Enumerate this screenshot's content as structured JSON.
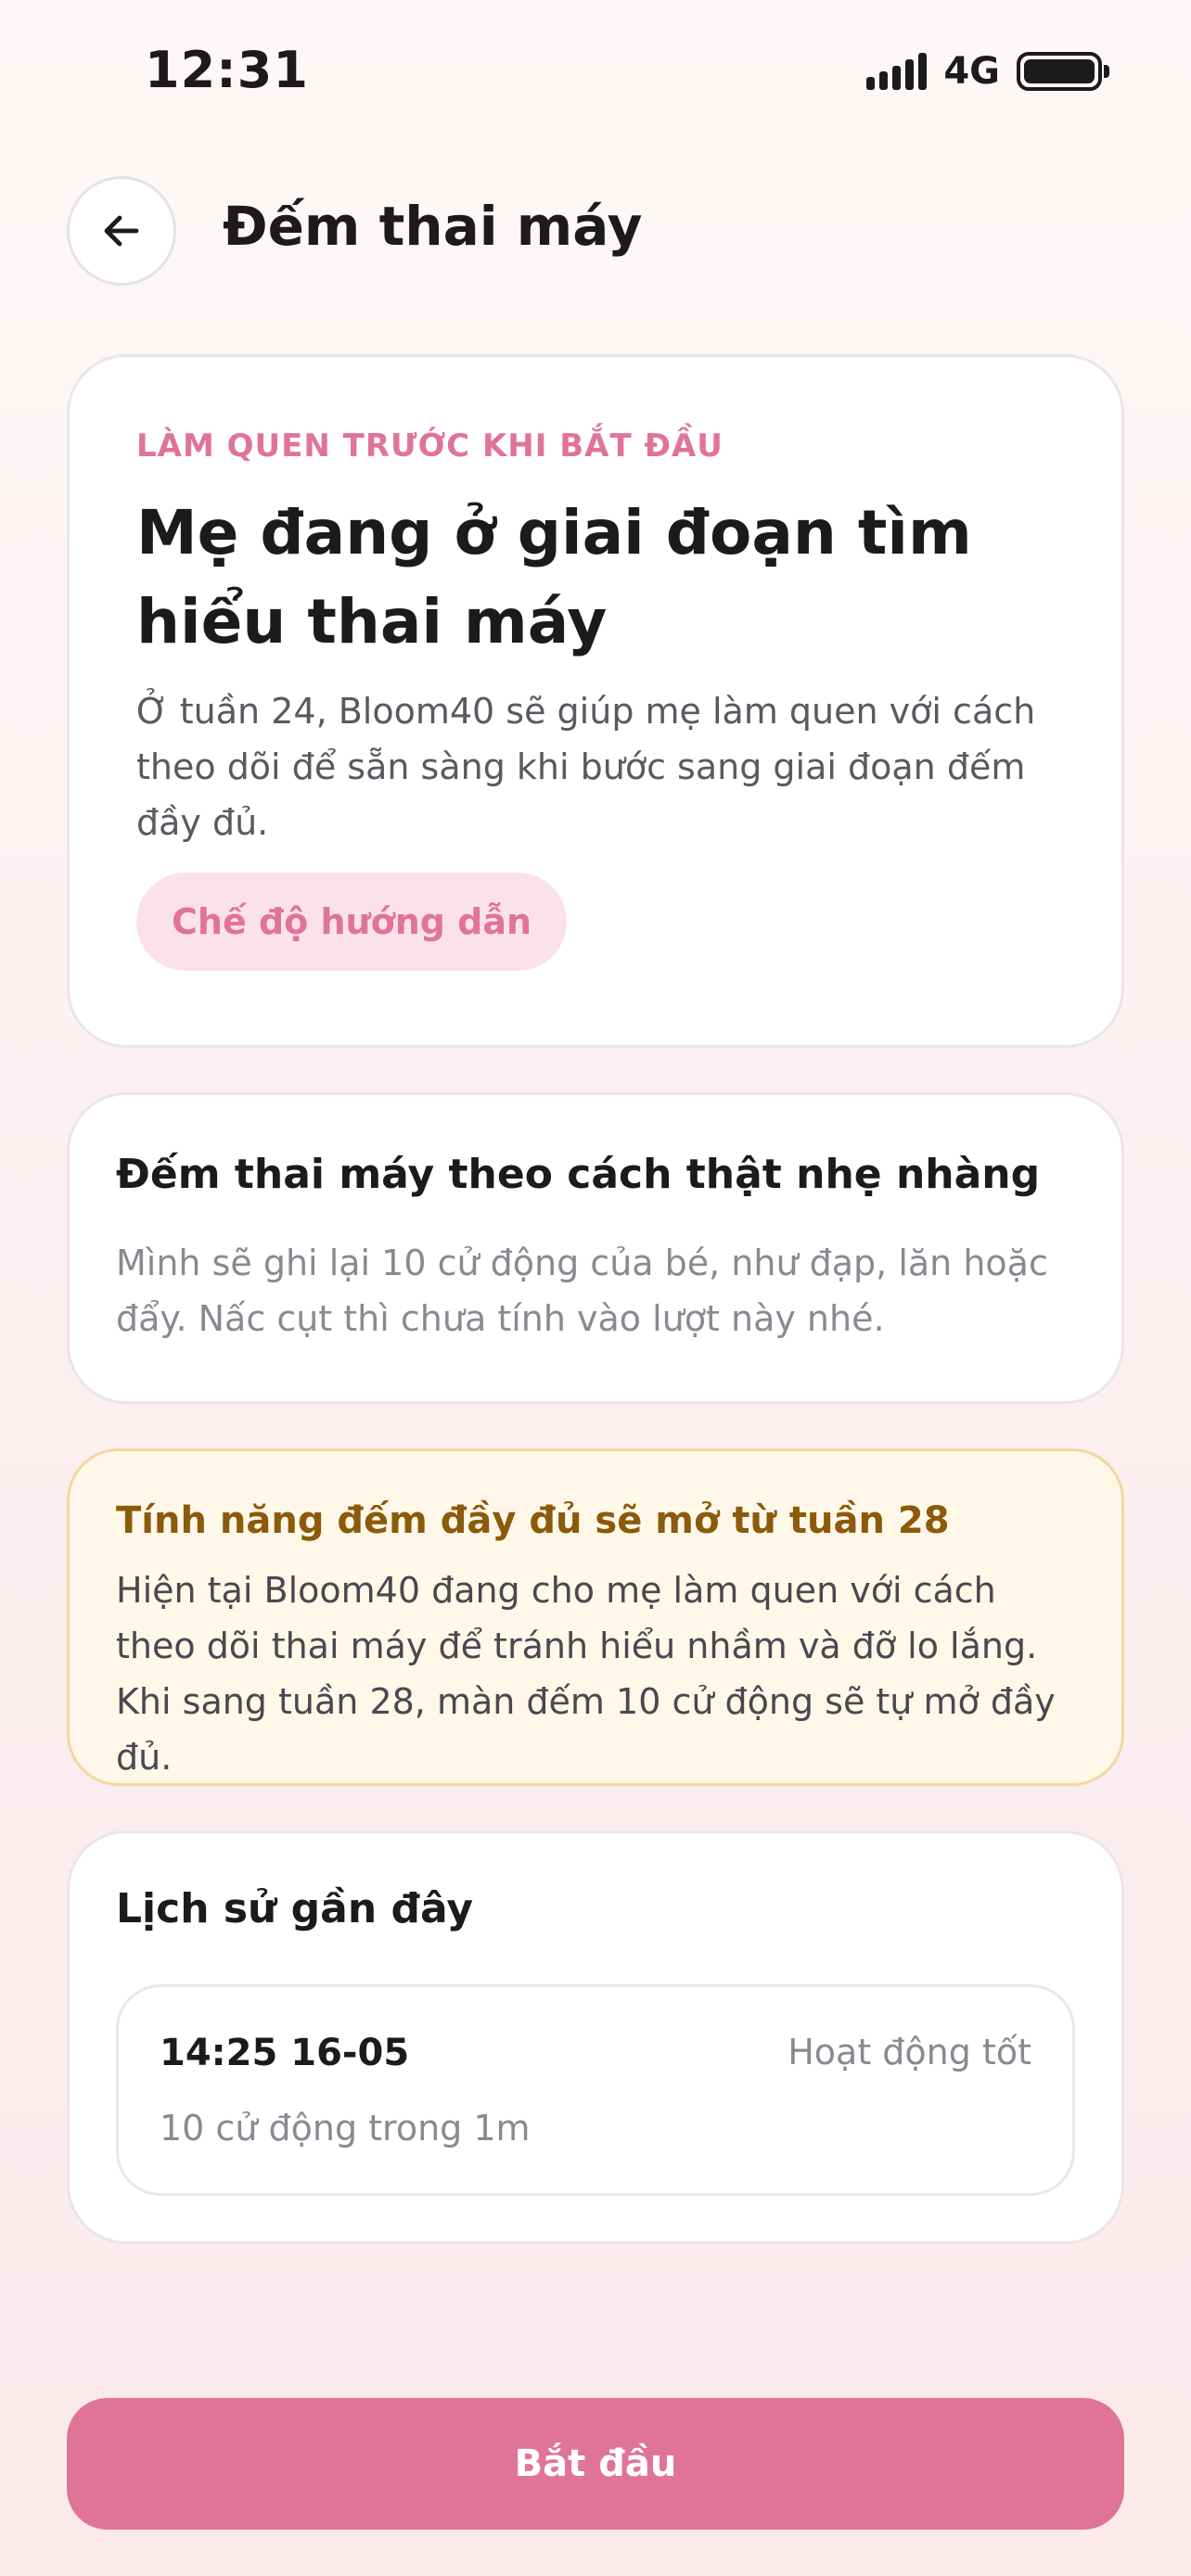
{
  "status_bar": {
    "time": "12:31",
    "network": "4G"
  },
  "header": {
    "title": "Đếm thai máy",
    "back_icon": "arrow-left-icon"
  },
  "intro_card": {
    "eyebrow": "LÀM QUEN TRƯỚC KHI BẮT ĐẦU",
    "heading": "Mẹ đang ở giai đoạn tìm hiểu thai máy",
    "body": "Ở tuần 24, Bloom40 sẽ giúp mẹ làm quen với cách theo dõi để sẵn sàng khi bước sang giai đoạn đếm đầy đủ.",
    "mode_pill": "Chế độ hướng dẫn"
  },
  "gentle_card": {
    "title": "Đếm thai máy theo cách thật nhẹ nhàng",
    "body": "Mình sẽ ghi lại 10 cử động của bé, như đạp, lăn hoặc đẩy. Nấc cụt thì chưa tính vào lượt này nhé."
  },
  "notice_card": {
    "title": "Tính năng đếm đầy đủ sẽ mở từ tuần 28",
    "body": "Hiện tại Bloom40 đang cho mẹ làm quen với cách theo dõi thai máy để tránh hiểu nhầm và đỡ lo lắng. Khi sang tuần 28, màn đếm 10 cử động sẽ tự mở đầy đủ."
  },
  "history": {
    "title": "Lịch sử gần đây",
    "items": [
      {
        "time": "14:25 16-05",
        "status": "Hoạt động tốt",
        "detail": "10 cử động trong 1m"
      }
    ]
  },
  "actions": {
    "start_label": "Bắt đầu"
  },
  "colors": {
    "accent": "#e07497",
    "pill_bg": "#fbe2ea",
    "notice_bg": "#fff7e8",
    "notice_border": "#f3d7a1",
    "notice_title": "#8b5a0a"
  }
}
